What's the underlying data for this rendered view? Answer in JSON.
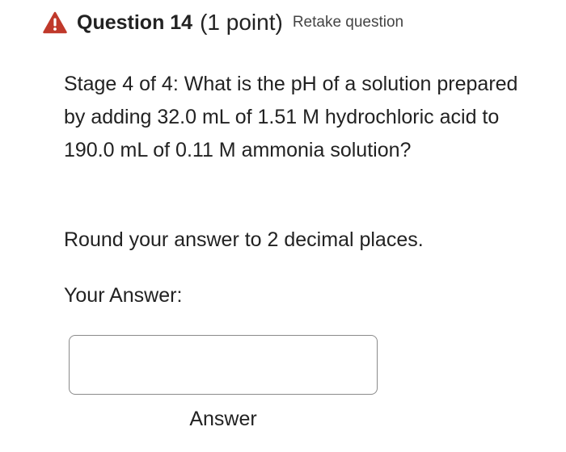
{
  "header": {
    "icon": "warning-triangle-icon",
    "icon_color": "#c0392b",
    "title": "Question 14",
    "points": "(1 point)",
    "retake": "Retake question"
  },
  "question": {
    "stage_text": "Stage 4 of 4:  What is the pH of a solution prepared by adding 32.0 mL of 1.51 M hydrochloric acid to 190.0 mL of 0.11 M ammonia solution?",
    "instruction": "Round your answer to 2 decimal places."
  },
  "answer": {
    "prompt": "Your Answer:",
    "value": "",
    "label": "Answer"
  }
}
